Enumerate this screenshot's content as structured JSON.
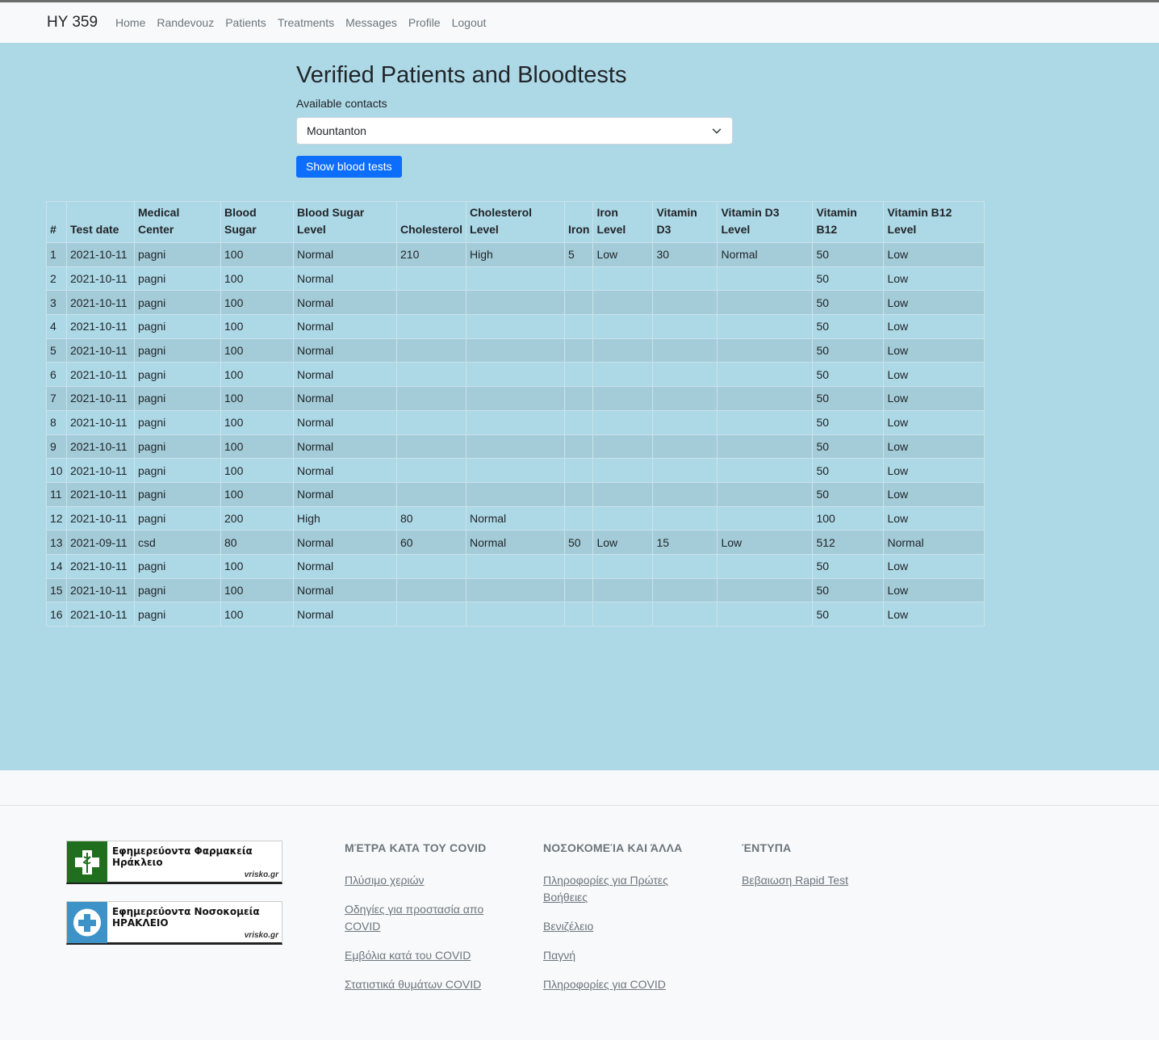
{
  "nav": {
    "brand": "HY 359",
    "links": [
      "Home",
      "Randevouz",
      "Patients",
      "Treatments",
      "Messages",
      "Profile",
      "Logout"
    ]
  },
  "main": {
    "title": "Verified Patients and Bloodtests",
    "contacts_label": "Available contacts",
    "contact_selected": "Mountanton",
    "show_button": "Show blood tests"
  },
  "table": {
    "headers": [
      "#",
      "Test date",
      "Medical Center",
      "Blood Sugar",
      "Blood Sugar Level",
      "Cholesterol",
      "Cholesterol Level",
      "Iron",
      "Iron Level",
      "Vitamin D3",
      "Vitamin D3 Level",
      "Vitamin B12",
      "Vitamin B12 Level"
    ],
    "rows": [
      [
        "1",
        "2021-10-11",
        "pagni",
        "100",
        "Normal",
        "210",
        "High",
        "5",
        "Low",
        "30",
        "Normal",
        "50",
        "Low"
      ],
      [
        "2",
        "2021-10-11",
        "pagni",
        "100",
        "Normal",
        "",
        "",
        "",
        "",
        "",
        "",
        "50",
        "Low"
      ],
      [
        "3",
        "2021-10-11",
        "pagni",
        "100",
        "Normal",
        "",
        "",
        "",
        "",
        "",
        "",
        "50",
        "Low"
      ],
      [
        "4",
        "2021-10-11",
        "pagni",
        "100",
        "Normal",
        "",
        "",
        "",
        "",
        "",
        "",
        "50",
        "Low"
      ],
      [
        "5",
        "2021-10-11",
        "pagni",
        "100",
        "Normal",
        "",
        "",
        "",
        "",
        "",
        "",
        "50",
        "Low"
      ],
      [
        "6",
        "2021-10-11",
        "pagni",
        "100",
        "Normal",
        "",
        "",
        "",
        "",
        "",
        "",
        "50",
        "Low"
      ],
      [
        "7",
        "2021-10-11",
        "pagni",
        "100",
        "Normal",
        "",
        "",
        "",
        "",
        "",
        "",
        "50",
        "Low"
      ],
      [
        "8",
        "2021-10-11",
        "pagni",
        "100",
        "Normal",
        "",
        "",
        "",
        "",
        "",
        "",
        "50",
        "Low"
      ],
      [
        "9",
        "2021-10-11",
        "pagni",
        "100",
        "Normal",
        "",
        "",
        "",
        "",
        "",
        "",
        "50",
        "Low"
      ],
      [
        "10",
        "2021-10-11",
        "pagni",
        "100",
        "Normal",
        "",
        "",
        "",
        "",
        "",
        "",
        "50",
        "Low"
      ],
      [
        "11",
        "2021-10-11",
        "pagni",
        "100",
        "Normal",
        "",
        "",
        "",
        "",
        "",
        "",
        "50",
        "Low"
      ],
      [
        "12",
        "2021-10-11",
        "pagni",
        "200",
        "High",
        "80",
        "Normal",
        "",
        "",
        "",
        "",
        "100",
        "Low"
      ],
      [
        "13",
        "2021-09-11",
        "csd",
        "80",
        "Normal",
        "60",
        "Normal",
        "50",
        "Low",
        "15",
        "Low",
        "512",
        "Normal"
      ],
      [
        "14",
        "2021-10-11",
        "pagni",
        "100",
        "Normal",
        "",
        "",
        "",
        "",
        "",
        "",
        "50",
        "Low"
      ],
      [
        "15",
        "2021-10-11",
        "pagni",
        "100",
        "Normal",
        "",
        "",
        "",
        "",
        "",
        "",
        "50",
        "Low"
      ],
      [
        "16",
        "2021-10-11",
        "pagni",
        "100",
        "Normal",
        "",
        "",
        "",
        "",
        "",
        "",
        "50",
        "Low"
      ]
    ]
  },
  "footer": {
    "banners": [
      {
        "line1": "Εφημερεύοντα Φαρμακεία",
        "line2": "Ηράκλειο",
        "tag": "vrisko.gr",
        "color": "#1f6f1f",
        "icon": "pharmacy-cross-icon"
      },
      {
        "line1": "Εφημερεύοντα Νοσοκομεία",
        "line2": "ΗΡΑΚΛΕΙΟ",
        "tag": "vrisko.gr",
        "color": "#3d93c7",
        "icon": "hospital-cross-icon"
      }
    ],
    "columns": [
      {
        "heading": "ΜΈΤΡΑ ΚΑΤΑ ΤΟΥ COVID",
        "links": [
          "Πλύσιμο χεριών",
          "Οδηγίες για προστασία απο COVID",
          "Εμβόλια κατά του COVID",
          "Στατιστικά θυμάτων COVID"
        ]
      },
      {
        "heading": "ΝΟΣΟΚΟΜΕΊΑ ΚΑΙ ΆΛΛΑ",
        "links": [
          "Πληροφορίες για Πρώτες Βοήθειες",
          "Βενιζέλειο",
          "Παγνή",
          "Πληροφορίες για COVID"
        ]
      },
      {
        "heading": "ΈΝΤΥΠΑ",
        "links": [
          "Βεβαιωση Rapid Test"
        ]
      }
    ]
  }
}
